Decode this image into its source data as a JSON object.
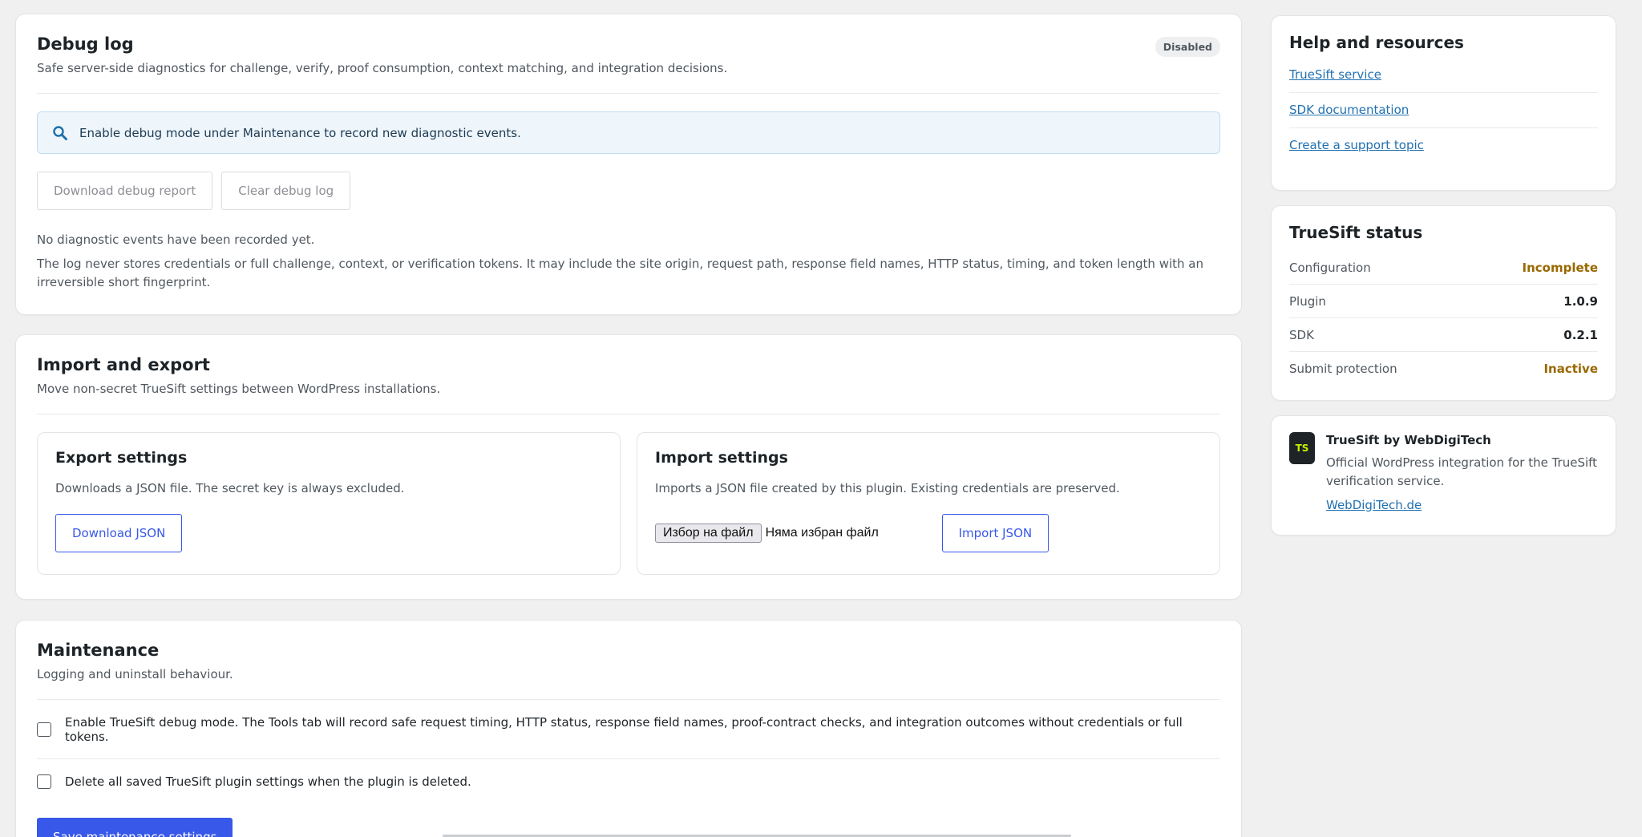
{
  "debug": {
    "title": "Debug log",
    "subtitle": "Safe server-side diagnostics for challenge, verify, proof consumption, context matching, and integration decisions.",
    "badge": "Disabled",
    "notice": "Enable debug mode under Maintenance to record new diagnostic events.",
    "download_label": "Download debug report",
    "clear_label": "Clear debug log",
    "empty_text": "No diagnostic events have been recorded yet.",
    "privacy_text": "The log never stores credentials or full challenge, context, or verification tokens. It may include the site origin, request path, response field names, HTTP status, timing, and token length with an irreversible short fingerprint."
  },
  "import_export": {
    "title": "Import and export",
    "subtitle": "Move non-secret TrueSift settings between WordPress installations.",
    "export": {
      "title": "Export settings",
      "desc": "Downloads a JSON file. The secret key is always excluded.",
      "button": "Download JSON"
    },
    "import": {
      "title": "Import settings",
      "desc": "Imports a JSON file created by this plugin. Existing credentials are preserved.",
      "file_button": "Избор на файл",
      "file_status": "Няма избран файл",
      "button": "Import JSON"
    }
  },
  "maintenance": {
    "title": "Maintenance",
    "subtitle": "Logging and uninstall behaviour.",
    "debug_mode_label": "Enable TrueSift debug mode. The Tools tab will record safe request timing, HTTP status, response field names, proof-contract checks, and integration outcomes without credentials or full tokens.",
    "delete_label": "Delete all saved TrueSift plugin settings when the plugin is deleted.",
    "save_label": "Save maintenance settings"
  },
  "help": {
    "title": "Help and resources",
    "links": [
      "TrueSift service",
      "SDK documentation",
      "Create a support topic"
    ]
  },
  "status": {
    "title": "TrueSift status",
    "rows": [
      {
        "label": "Configuration",
        "value": "Incomplete"
      },
      {
        "label": "Plugin",
        "value": "1.0.9"
      },
      {
        "label": "SDK",
        "value": "0.2.1"
      },
      {
        "label": "Submit protection",
        "value": "Inactive"
      }
    ]
  },
  "brand": {
    "logo": "TS",
    "title": "TrueSift by WebDigiTech",
    "desc": "Official WordPress integration for the TrueSift verification service.",
    "link": "WebDigiTech.de"
  },
  "colors": {
    "accent": "#3858e9",
    "warning": "#996800",
    "link": "#2271b1"
  }
}
